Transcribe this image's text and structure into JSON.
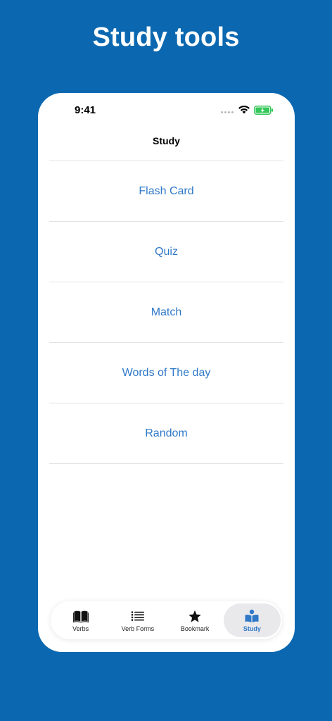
{
  "headline": "Study tools",
  "status_bar": {
    "time": "9:41"
  },
  "nav": {
    "title": "Study"
  },
  "study_options": [
    {
      "label": "Flash Card"
    },
    {
      "label": "Quiz"
    },
    {
      "label": "Match"
    },
    {
      "label": "Words of The day"
    },
    {
      "label": "Random"
    }
  ],
  "tabbar": {
    "tabs": [
      {
        "label": "Verbs",
        "icon": "book-icon"
      },
      {
        "label": "Verb Forms",
        "icon": "list-icon"
      },
      {
        "label": "Bookmark",
        "icon": "star-icon"
      },
      {
        "label": "Study",
        "icon": "reader-icon",
        "selected": true
      }
    ]
  },
  "colors": {
    "background": "#0b68b0",
    "accent": "#2f78c8",
    "battery_green": "#34c759"
  }
}
